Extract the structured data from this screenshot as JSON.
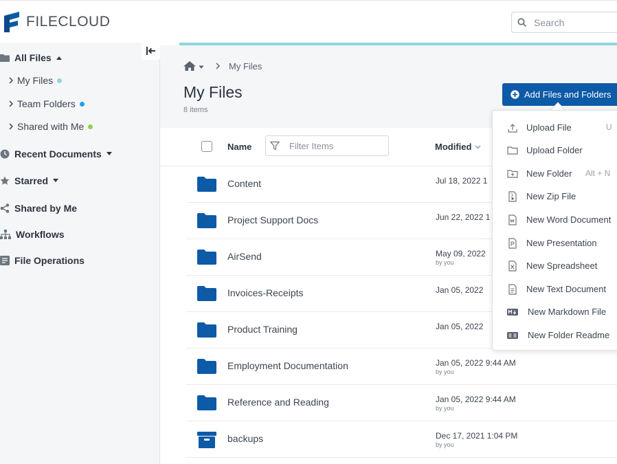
{
  "app": {
    "logo_text": "FILECLOUD"
  },
  "search": {
    "placeholder": "Search"
  },
  "sidebar": {
    "all_files": "All Files",
    "sub_items": [
      {
        "label": "My Files",
        "dot_color": "#8fd6df"
      },
      {
        "label": "Team Folders",
        "dot_color": "#1ea1f1"
      },
      {
        "label": "Shared with Me",
        "dot_color": "#8fd14f"
      }
    ],
    "recent": "Recent Documents",
    "starred": "Starred",
    "shared_by_me": "Shared by Me",
    "workflows": "Workflows",
    "file_operations": "File Operations"
  },
  "breadcrumb": {
    "current": "My Files"
  },
  "page": {
    "title": "My Files",
    "count": "8 items"
  },
  "add_button": {
    "label": "Add Files and Folders"
  },
  "columns": {
    "name": "Name",
    "filter_placeholder": "Filter Items",
    "modified": "Modified"
  },
  "files": [
    {
      "name": "Content",
      "date": "Jul 18, 2022 1",
      "by": "",
      "type": "folder"
    },
    {
      "name": "Project Support Docs",
      "date": "Jun 22, 2022 1",
      "by": "",
      "type": "folder"
    },
    {
      "name": "AirSend",
      "date": "May 09, 2022",
      "by": "by you",
      "type": "folder"
    },
    {
      "name": "Invoices-Receipts",
      "date": "Jan 05, 2022",
      "by": "",
      "type": "folder"
    },
    {
      "name": "Product Training",
      "date": "Jan 05, 2022",
      "by": "",
      "type": "folder"
    },
    {
      "name": "Employment Documentation",
      "date": "Jan 05, 2022 9:44 AM",
      "by": "by you",
      "type": "folder"
    },
    {
      "name": "Reference and Reading",
      "date": "Jan 05, 2022 9:44 AM",
      "by": "by you",
      "type": "folder"
    },
    {
      "name": "backups",
      "date": "Dec 17, 2021 1:04 PM",
      "by": "by you",
      "type": "archive"
    }
  ],
  "menu": {
    "items": [
      {
        "label": "Upload File",
        "shortcut": "U",
        "icon": "upload-file-icon"
      },
      {
        "label": "Upload Folder",
        "shortcut": "",
        "icon": "upload-folder-icon"
      },
      {
        "label": "New Folder",
        "shortcut": "Alt + N",
        "icon": "new-folder-icon"
      },
      {
        "label": "New Zip File",
        "shortcut": "",
        "icon": "zip-file-icon"
      },
      {
        "label": "New Word Document",
        "shortcut": "",
        "icon": "word-doc-icon"
      },
      {
        "label": "New Presentation",
        "shortcut": "",
        "icon": "presentation-icon"
      },
      {
        "label": "New Spreadsheet",
        "shortcut": "",
        "icon": "spreadsheet-icon"
      },
      {
        "label": "New Text Document",
        "shortcut": "",
        "icon": "text-doc-icon"
      },
      {
        "label": "New Markdown File",
        "shortcut": "",
        "icon": "markdown-icon"
      },
      {
        "label": "New Folder Readme",
        "shortcut": "",
        "icon": "readme-icon"
      }
    ]
  },
  "colors": {
    "primary": "#0d5aa7",
    "accent": "#8fd6df",
    "folder": "#0d5aa7"
  }
}
